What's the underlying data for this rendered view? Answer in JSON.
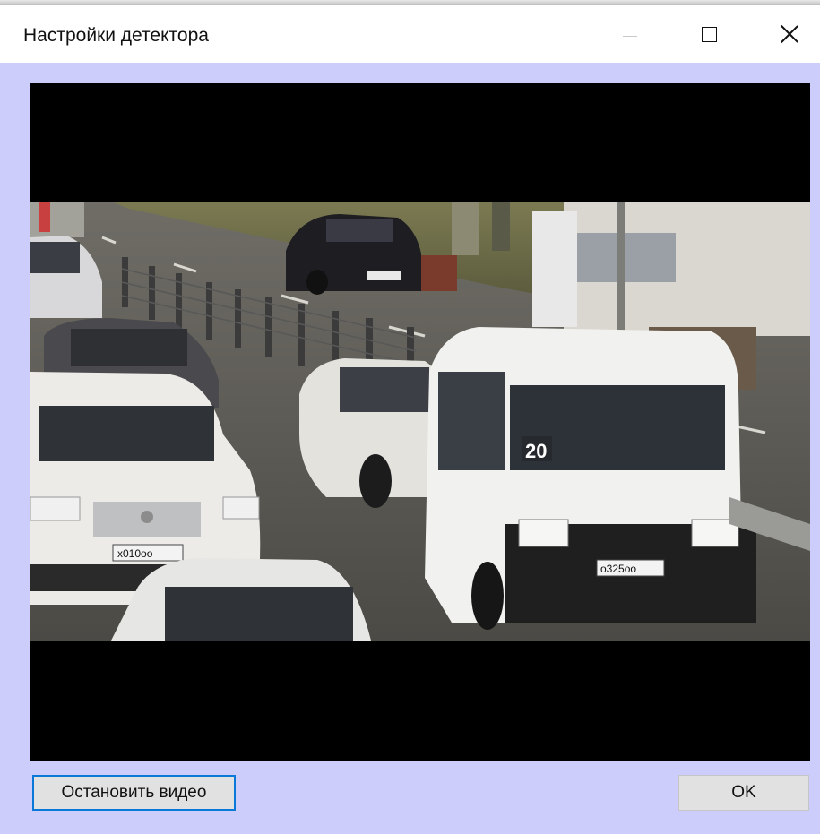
{
  "window": {
    "title": "Настройки детектора",
    "controls": {
      "minimize": "minimize-icon",
      "maximize": "maximize-icon",
      "close": "close-icon"
    }
  },
  "video": {
    "plates": {
      "suv": "х010оо",
      "minibus": "о325оо",
      "minibus_route": "20"
    }
  },
  "buttons": {
    "stop_video": "Остановить видео",
    "ok": "OK"
  },
  "colors": {
    "window_bg": "#cccdfa",
    "focus_border": "#0a78d7",
    "button_bg": "#e1e1e1"
  }
}
